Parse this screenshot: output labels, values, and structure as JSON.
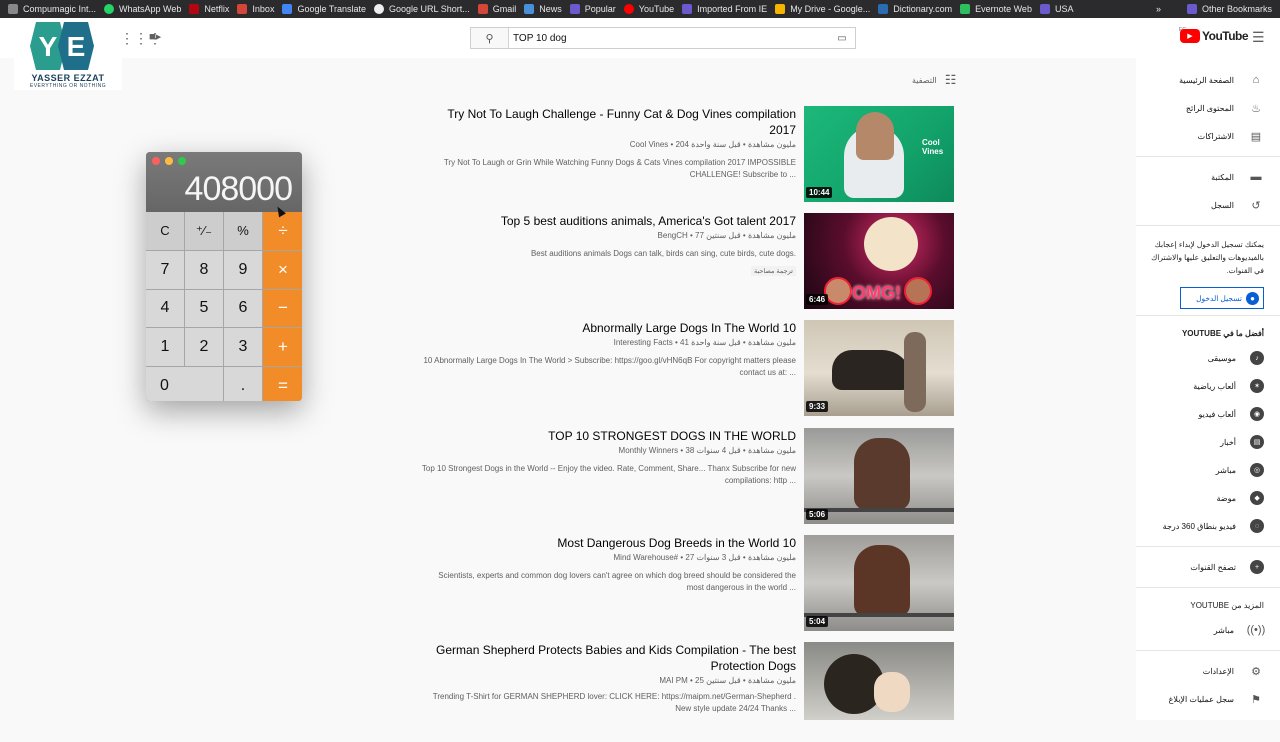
{
  "bookmarks": {
    "items": [
      "Compumagic Int...",
      "WhatsApp Web",
      "Netflix",
      "Inbox",
      "Google Translate",
      "Google URL Short...",
      "Gmail",
      "News",
      "Popular",
      "YouTube",
      "Imported From IE",
      "My Drive - Google...",
      "Dictionary.com",
      "Evernote Web",
      "USA"
    ],
    "more": "»",
    "other": "Other Bookmarks"
  },
  "channel_logo": {
    "title": "YASSER EZZAT",
    "subtitle": "EVERYTHING OR NOTHING",
    "initials": "YE"
  },
  "search": {
    "query": "TOP 10 dog"
  },
  "youtube": {
    "logo_text": "YouTube",
    "region": "EG"
  },
  "filter": {
    "label": "التصفية"
  },
  "results": [
    {
      "title": "Try Not To Laugh Challenge - Funny Cat & Dog Vines compilation 2017",
      "meta": "Cool Vines • 204 مليون مشاهدة • قبل سنة واحدة",
      "desc": "Try Not To Laugh or Grin While Watching Funny Dogs & Cats Vines compilation 2017 IMPOSSIBLE CHALLENGE! Subscribe to ...",
      "duration": "10:44",
      "thumb_caption": "Cool Vines"
    },
    {
      "title": "Top 5 best auditions animals, America's Got talent 2017",
      "meta": "BengCH • 77 مليون مشاهدة • قبل سنتين",
      "desc": "Best auditions animals Dogs can talk, birds can sing, cute birds, cute dogs.",
      "badge": "ترجمة مصاحبة",
      "duration": "6:46",
      "thumb_caption": "OMG!"
    },
    {
      "title": "Abnormally Large Dogs In The World 10",
      "meta": "Interesting Facts • 41 مليون مشاهدة • قبل سنة واحدة",
      "desc": "10 Abnormally Large Dogs In The World > Subscribe: https://goo.gl/vHN6qB For copyright matters please contact us at: ...",
      "duration": "9:33"
    },
    {
      "title": "TOP 10 STRONGEST DOGS IN THE WORLD",
      "meta": "Monthly Winners • 38 مليون مشاهدة • قبل 4 سنوات",
      "desc": "Top 10 Strongest Dogs in the World -- Enjoy the video. Rate, Comment, Share... Thanx Subscribe for new compilations: http ...",
      "duration": "5:06"
    },
    {
      "title": "Most Dangerous Dog Breeds in the World 10",
      "meta": "Mind Warehouse# • 27 مليون مشاهدة • قبل 3 سنوات",
      "desc": "Scientists, experts and common dog lovers can't agree on which dog breed should be considered the most dangerous in the world ...",
      "duration": "5:04"
    },
    {
      "title": "German Shepherd Protects Babies and Kids Compilation - The best Protection Dogs",
      "meta": "MAI PM • 25 مليون مشاهدة • قبل سنتين",
      "desc": "Trending T-Shirt for GERMAN SHEPHERD lover: CLICK HERE: https://maipm.net/German-Shepherd . New style update 24/24 Thanks ..."
    }
  ],
  "sidebar": {
    "nav": [
      "الصفحة الرئيسية",
      "المحتوى الرائج",
      "الاشتراكات"
    ],
    "library": [
      "المكتبة",
      "السجل"
    ],
    "signin_msg": "يمكنك تسجيل الدخول لإبداء إعجابك بالفيديوهات والتعليق عليها والاشتراك في القنوات.",
    "signin_btn": "تسجيل الدخول",
    "best_heading": "أفضل ما في YOUTUBE",
    "best": [
      "موسيقى",
      "ألعاب رياضية",
      "ألعاب فيديو",
      "أخبار",
      "مباشر",
      "موضة",
      "فيديو بنطاق 360 درجة"
    ],
    "browse": "تصفح القنوات",
    "more_heading": "المزيد من YOUTUBE",
    "more": [
      "مباشر"
    ],
    "settings": [
      "الإعدادات",
      "سجل عمليات الإبلاغ"
    ]
  },
  "calculator": {
    "display": "408000",
    "keys": [
      "C",
      "⁺∕₋",
      "%",
      "÷",
      "7",
      "8",
      "9",
      "×",
      "4",
      "5",
      "6",
      "−",
      "1",
      "2",
      "3",
      "+",
      "0",
      ".",
      "="
    ]
  }
}
